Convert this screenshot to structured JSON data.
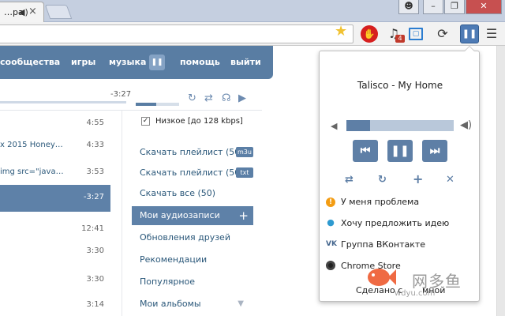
{
  "browser": {
    "tab": {
      "title": "…ра",
      "audio_icon": "speaker-icon",
      "close_icon": "×"
    },
    "window_buttons": {
      "user": "user-icon",
      "minimize": "minimize-icon",
      "maximize": "maximize-icon",
      "close": "close-icon"
    },
    "toolbar": {
      "bookmark_icon": "star-icon",
      "extensions": [
        "stop-icon",
        "music-note-icon",
        "fit-screen-icon",
        "reload-icon",
        "vk-player-icon",
        "menu-icon"
      ],
      "music_badge": "4"
    }
  },
  "vk": {
    "nav": {
      "items": [
        "сообщества",
        "игры",
        "музыка",
        "помощь",
        "выйти"
      ]
    },
    "player": {
      "time": "-3:27",
      "volume_fraction": 0.48
    },
    "tracks": [
      {
        "title": "",
        "duration": "4:55"
      },
      {
        "title": "x 2015 Honey…",
        "duration": "4:33"
      },
      {
        "title": "img src=\"java…",
        "duration": "3:53"
      },
      {
        "title": "",
        "duration": "-3:27",
        "active": true
      },
      {
        "title": "",
        "duration": "12:41"
      },
      {
        "title": "",
        "duration": "3:30"
      },
      {
        "title": "",
        "duration": "3:30"
      },
      {
        "title": "",
        "duration": "3:14"
      }
    ],
    "sidebar": {
      "quality_label": "Низкое [до 128 kbps]",
      "download_links": [
        {
          "label": "Скачать плейлист (50)",
          "badge": "m3u"
        },
        {
          "label": "Скачать плейлист (50)",
          "badge": "txt"
        },
        {
          "label": "Скачать все (50)",
          "badge": ""
        }
      ],
      "items": [
        {
          "label": "Мои аудиозаписи",
          "active": true
        },
        {
          "label": "Обновления друзей"
        },
        {
          "label": "Рекомендации"
        },
        {
          "label": "Популярное"
        },
        {
          "label": "Мои альбомы"
        }
      ]
    }
  },
  "popup": {
    "now_playing": "Talisco - My Home",
    "progress_fraction": 0.22,
    "controls": {
      "prev": "⏮",
      "pause": "❚❚",
      "next": "⏭"
    },
    "secondary_controls": [
      "shuffle-icon",
      "repeat-icon",
      "add-icon",
      "close-icon"
    ],
    "menu": [
      {
        "icon": "warning-icon",
        "label": "У меня проблема"
      },
      {
        "icon": "lightbulb-icon",
        "label": "Хочу предложить идею"
      },
      {
        "icon": "vk-icon",
        "label": "Группа ВКонтакте"
      },
      {
        "icon": "chrome-icon",
        "label": "Chrome Store"
      }
    ],
    "footer_left": "Сделано с",
    "footer_right": "мной"
  },
  "watermark": {
    "text": "网多鱼",
    "small": "wdyu.com"
  }
}
